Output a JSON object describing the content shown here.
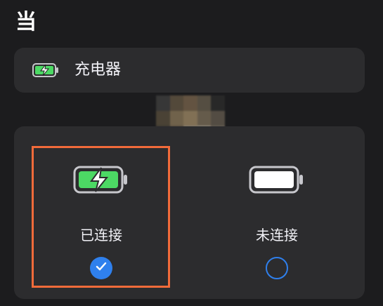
{
  "header": {
    "title": "当"
  },
  "charger": {
    "label": "充电器",
    "icon": "battery-charging-icon"
  },
  "states": {
    "connected": {
      "label": "已连接",
      "icon": "battery-charging-icon",
      "selected": true
    },
    "disconnected": {
      "label": "未连接",
      "icon": "battery-full-icon",
      "selected": false
    }
  },
  "colors": {
    "background": "#1c1c1e",
    "card": "#2c2c2e",
    "battery_green": "#4cd964",
    "accent_blue": "#2f80ed",
    "highlight_orange": "#f26b3a"
  }
}
